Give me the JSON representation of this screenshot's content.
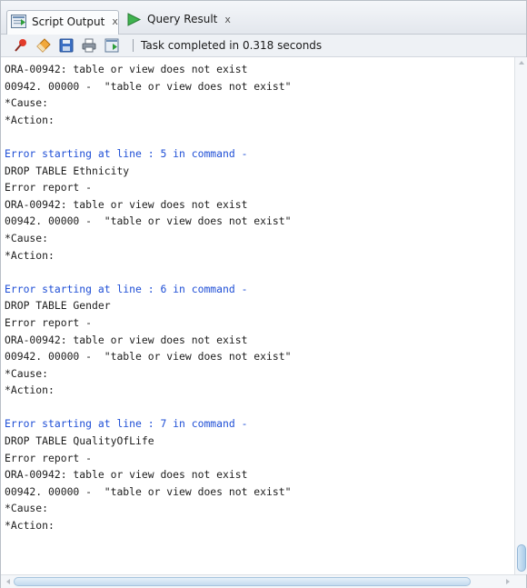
{
  "tabs": [
    {
      "label": "Script Output",
      "close": "x",
      "active": true,
      "icon": "script-output-icon"
    },
    {
      "label": "Query Result",
      "close": "x",
      "active": false,
      "icon": "play-triangle-icon"
    }
  ],
  "toolbar": {
    "buttons": [
      "pin-icon",
      "eraser-icon",
      "save-icon",
      "print-icon",
      "script-icon"
    ],
    "status": "Task completed in 0.318 seconds"
  },
  "colors": {
    "error_heading": "#1f4fd6",
    "text": "#1d1d1d",
    "tab_icon_green": "#2e9e3b"
  },
  "output_lines": [
    {
      "type": "normal",
      "text": "ORA-00942: table or view does not exist"
    },
    {
      "type": "normal",
      "text": "00942. 00000 -  \"table or view does not exist\""
    },
    {
      "type": "normal",
      "text": "*Cause:"
    },
    {
      "type": "normal",
      "text": "*Action:"
    },
    {
      "type": "blank",
      "text": ""
    },
    {
      "type": "err-head",
      "text": "Error starting at line : 5 in command -"
    },
    {
      "type": "normal",
      "text": "DROP TABLE Ethnicity"
    },
    {
      "type": "normal",
      "text": "Error report -"
    },
    {
      "type": "normal",
      "text": "ORA-00942: table or view does not exist"
    },
    {
      "type": "normal",
      "text": "00942. 00000 -  \"table or view does not exist\""
    },
    {
      "type": "normal",
      "text": "*Cause:"
    },
    {
      "type": "normal",
      "text": "*Action:"
    },
    {
      "type": "blank",
      "text": ""
    },
    {
      "type": "err-head",
      "text": "Error starting at line : 6 in command -"
    },
    {
      "type": "normal",
      "text": "DROP TABLE Gender"
    },
    {
      "type": "normal",
      "text": "Error report -"
    },
    {
      "type": "normal",
      "text": "ORA-00942: table or view does not exist"
    },
    {
      "type": "normal",
      "text": "00942. 00000 -  \"table or view does not exist\""
    },
    {
      "type": "normal",
      "text": "*Cause:"
    },
    {
      "type": "normal",
      "text": "*Action:"
    },
    {
      "type": "blank",
      "text": ""
    },
    {
      "type": "err-head",
      "text": "Error starting at line : 7 in command -"
    },
    {
      "type": "normal",
      "text": "DROP TABLE QualityOfLife"
    },
    {
      "type": "normal",
      "text": "Error report -"
    },
    {
      "type": "normal",
      "text": "ORA-00942: table or view does not exist"
    },
    {
      "type": "normal",
      "text": "00942. 00000 -  \"table or view does not exist\""
    },
    {
      "type": "normal",
      "text": "*Cause:"
    },
    {
      "type": "normal",
      "text": "*Action:"
    }
  ]
}
